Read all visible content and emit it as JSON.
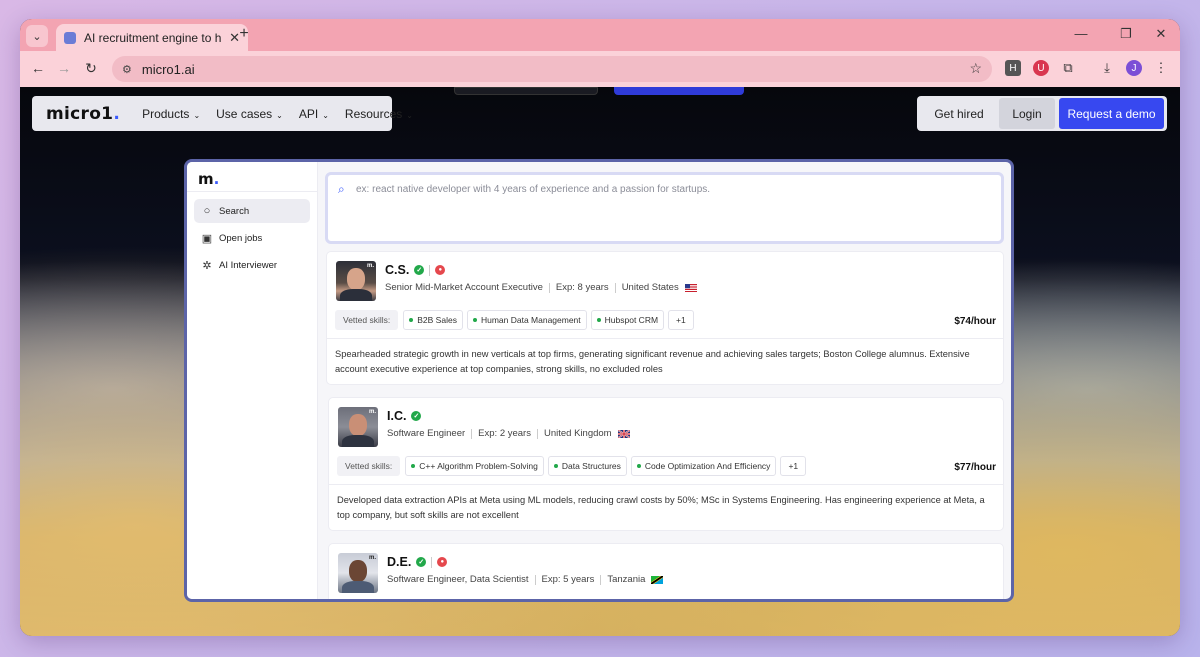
{
  "browser": {
    "tab_title": "AI recruitment engine to hire to",
    "tab_close": "✕",
    "new_tab": "+",
    "url": "micro1.ai",
    "avatar_letter": "J",
    "icons": [
      "back-arrow-icon",
      "forward-arrow-icon",
      "reload-icon",
      "site-info-icon",
      "bookmark-star-icon",
      "extension-puzzle-icon",
      "download-icon",
      "kebab-menu-icon"
    ]
  },
  "site_nav": {
    "logo": "micro1",
    "logo_dot": ".",
    "items": [
      {
        "label": "Products"
      },
      {
        "label": "Use cases"
      },
      {
        "label": "API"
      },
      {
        "label": "Resources"
      }
    ],
    "get_hired": "Get hired",
    "login": "Login",
    "request_demo": "Request a demo"
  },
  "app": {
    "logo": "m",
    "logo_dot": ".",
    "sidebar": [
      {
        "label": "Search",
        "icon": "search-icon",
        "active": true
      },
      {
        "label": "Open jobs",
        "icon": "briefcase-icon",
        "active": false
      },
      {
        "label": "AI Interviewer",
        "icon": "ai-chip-icon",
        "active": false
      }
    ],
    "search": {
      "placeholder": "ex: react native developer with 4 years of experience and a passion for startups."
    },
    "vetted_label": "Vetted skills:",
    "candidates": [
      {
        "name": "C.S.",
        "title": "Senior Mid-Market Account Executive",
        "exp": "Exp: 8 years",
        "location": "United States",
        "skills": [
          "B2B Sales",
          "Human Data Management",
          "Hubspot CRM"
        ],
        "more": "+1",
        "rate": "$74/hour",
        "description": "Spearheaded strategic growth in new verticals at top firms, generating significant revenue and achieving sales targets; Boston College alumnus. Extensive account executive experience at top companies, strong skills, no excluded roles"
      },
      {
        "name": "I.C.",
        "title": "Software Engineer",
        "exp": "Exp: 2 years",
        "location": "United Kingdom",
        "skills": [
          "C++ Algorithm Problem-Solving",
          "Data Structures",
          "Code Optimization And Efficiency"
        ],
        "more": "+1",
        "rate": "$77/hour",
        "description": "Developed data extraction APIs at Meta using ML models, reducing crawl costs by 50%; MSc in Systems Engineering. Has engineering experience at Meta, a top company, but soft skills are not excellent"
      },
      {
        "name": "D.E.",
        "title": "Software Engineer, Data Scientist",
        "exp": "Exp: 5 years",
        "location": "Tanzania"
      }
    ]
  }
}
